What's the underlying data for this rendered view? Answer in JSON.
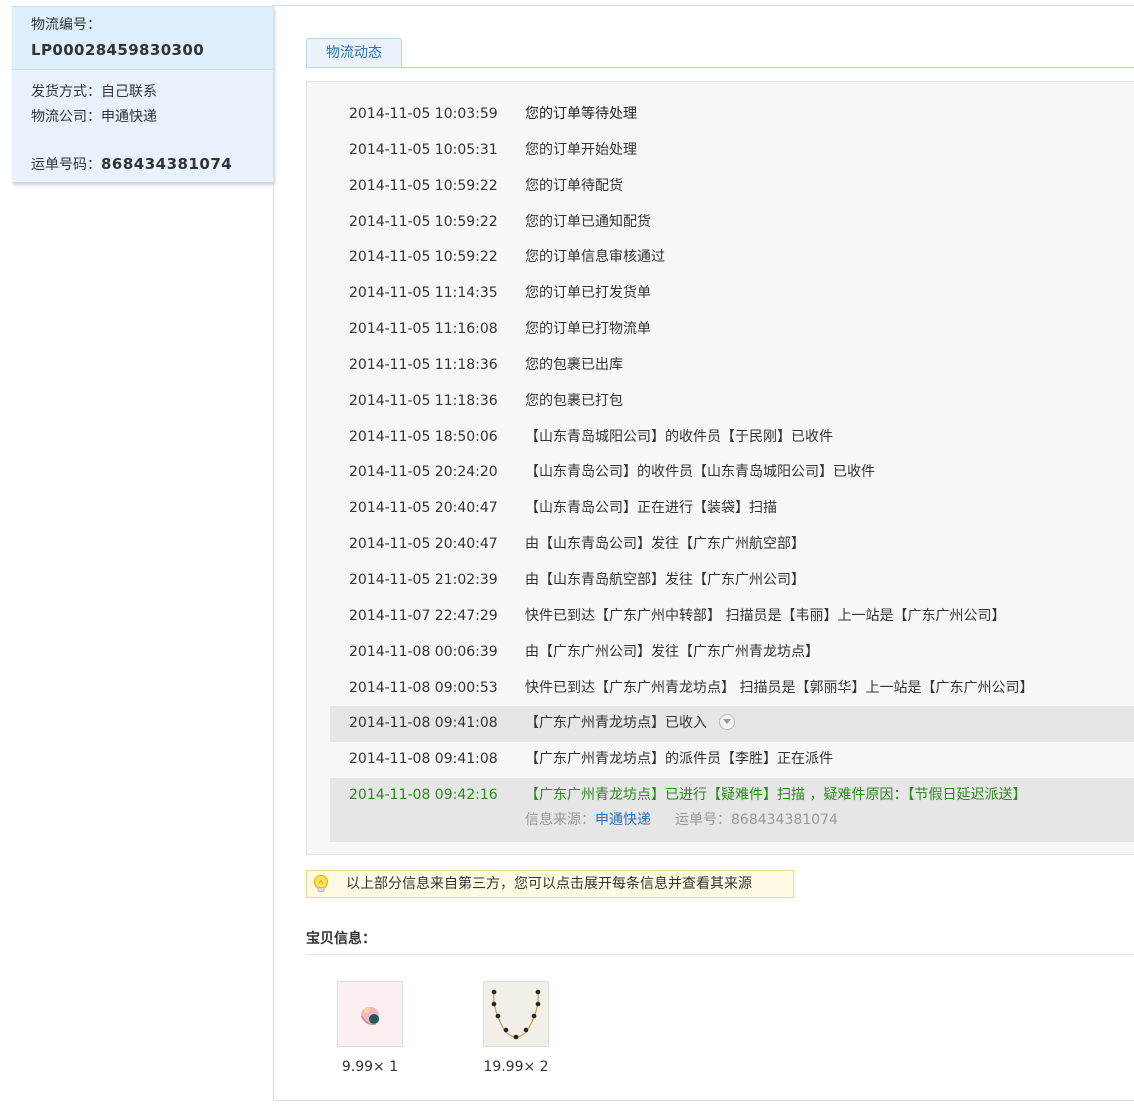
{
  "order": {
    "number_label": "物流编号：",
    "number": "LP00028459830300",
    "ship_method": "发货方式：自己联系",
    "company": "物流公司：申通快递",
    "waybill_label": "运单号码：",
    "waybill": "868434381074"
  },
  "tab": "物流动态",
  "events": [
    {
      "time": "2014-11-05 10:03:59",
      "desc": "您的订单等待处理"
    },
    {
      "time": "2014-11-05 10:05:31",
      "desc": "您的订单开始处理"
    },
    {
      "time": "2014-11-05 10:59:22",
      "desc": "您的订单待配货"
    },
    {
      "time": "2014-11-05 10:59:22",
      "desc": "您的订单已通知配货"
    },
    {
      "time": "2014-11-05 10:59:22",
      "desc": "您的订单信息审核通过"
    },
    {
      "time": "2014-11-05 11:14:35",
      "desc": "您的订单已打发货单"
    },
    {
      "time": "2014-11-05 11:16:08",
      "desc": "您的订单已打物流单"
    },
    {
      "time": "2014-11-05 11:18:36",
      "desc": "您的包裹已出库"
    },
    {
      "time": "2014-11-05 11:18:36",
      "desc": "您的包裹已打包"
    },
    {
      "time": "2014-11-05 18:50:06",
      "desc": "【山东青岛城阳公司】的收件员【于民刚】已收件"
    },
    {
      "time": "2014-11-05 20:24:20",
      "desc": "【山东青岛公司】的收件员【山东青岛城阳公司】已收件"
    },
    {
      "time": "2014-11-05 20:40:47",
      "desc": "【山东青岛公司】正在进行【装袋】扫描"
    },
    {
      "time": "2014-11-05 20:40:47",
      "desc": "由【山东青岛公司】发往【广东广州航空部】"
    },
    {
      "time": "2014-11-05 21:02:39",
      "desc": "由【山东青岛航空部】发往【广东广州公司】"
    },
    {
      "time": "2014-11-07 22:47:29",
      "desc": "快件已到达【广东广州中转部】 扫描员是【韦丽】上一站是【广东广州公司】"
    },
    {
      "time": "2014-11-08 00:06:39",
      "desc": "由【广东广州公司】发往【广东广州青龙坊点】"
    },
    {
      "time": "2014-11-08 09:00:53",
      "desc": "快件已到达【广东广州青龙坊点】 扫描员是【郭丽华】上一站是【广东广州公司】"
    },
    {
      "time": "2014-11-08 09:41:08",
      "desc": "【广东广州青龙坊点】已收入"
    },
    {
      "time": "2014-11-08 09:41:08",
      "desc": "【广东广州青龙坊点】的派件员【李胜】正在派件"
    },
    {
      "time": "2014-11-08 09:42:16",
      "desc": "【广东广州青龙坊点】已进行【疑难件】扫描 ，疑难件原因：【节假日延迟派送】"
    }
  ],
  "source": {
    "label": "信息来源：",
    "company": "申通快递",
    "waybill_label": "运单号：",
    "waybill": "868434381074"
  },
  "notice": "以上部分信息来自第三方，您可以点击展开每条信息并查看其来源",
  "goods_title": "宝贝信息：",
  "goods": [
    {
      "price": "9.99× 1"
    },
    {
      "price": "19.99× 2"
    }
  ],
  "colors": {
    "accent": "#2a73b8",
    "status_green": "#2d8a1f",
    "panel_bg": "#e8f2fd",
    "notice_bg": "#fffbe3"
  }
}
